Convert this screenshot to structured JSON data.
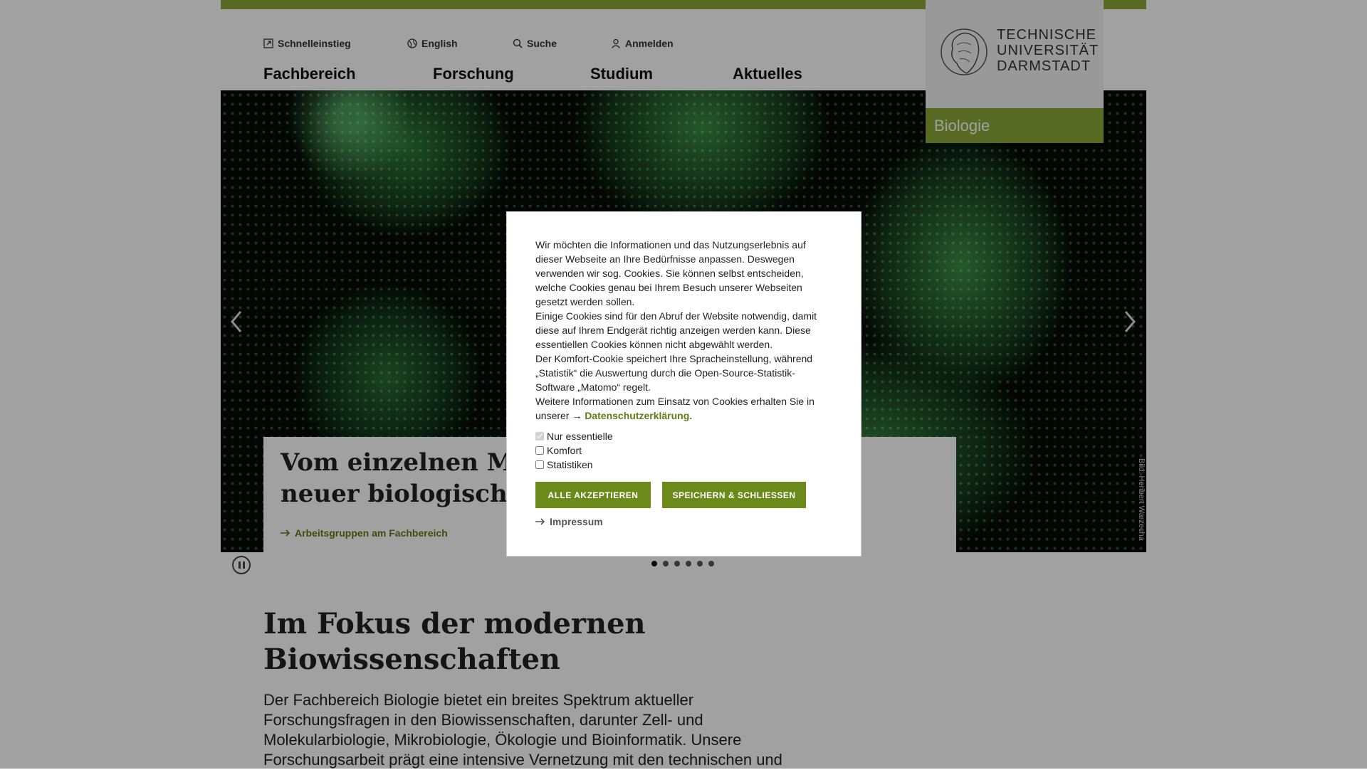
{
  "header": {
    "meta": {
      "quick": "Schnelleinstieg",
      "lang": "English",
      "search": "Suche",
      "login": "Anmelden"
    },
    "nav": [
      "Fachbereich",
      "Forschung",
      "Studium",
      "Aktuelles"
    ],
    "logo_lines": [
      "TECHNISCHE",
      "UNIVERSITÄT",
      "DARMSTADT"
    ],
    "department": "Biologie"
  },
  "hero": {
    "title": "Vom einzelnen Molekül zum Engineering neuer biologischer Systeme",
    "link": "Arbeitsgruppen am Fachbereich",
    "credit": "Bild: Heribert Warzecha",
    "slides_total": 6,
    "active_slide": 1
  },
  "intro": {
    "title": "Im Fokus der modernen Biowissenschaften",
    "text": "Der Fachbereich Biologie bietet ein breites Spektrum aktueller Forschungsfragen in den Biowissenschaften, darunter Zell- und Molekularbiologie, Mikrobiologie, Ökologie und Bioinformatik. Unsere Forschungsarbeit prägt eine intensive Vernetzung mit den technischen und"
  },
  "cookie": {
    "p1": "Wir möchten die Informationen und das Nutzungserlebnis auf dieser Webseite an Ihre Bedürfnisse anpassen. Deswegen verwenden wir sog. Cookies. Sie können selbst entscheiden, welche Cookies genau bei Ihrem Besuch unserer Webseiten gesetzt werden sollen.",
    "p2": "Einige Cookies sind für den Abruf der Website notwendig, damit diese auf Ihrem Endgerät richtig anzeigen werden kann. Diese essentiellen Cookies können nicht abgewählt werden.",
    "p3": "Der Komfort-Cookie speichert Ihre Spracheinstellung, während „Statistik“ die Auswertung durch die Open-Source-Statistik-Software „Matomo“ regelt.",
    "p4": "Weitere Informationen zum Einsatz von Cookies erhalten Sie in unserer",
    "privacy_link": "Datenschutzerklärung.",
    "options": [
      "Nur essentielle",
      "Komfort",
      "Statistiken"
    ],
    "accept_all": "ALLE AKZEPTIEREN",
    "save_close": "SPEICHERN & SCHLIESSEN",
    "impressum": "Impressum"
  },
  "colors": {
    "accent": "#8ea83a",
    "button": "#6b8a1a",
    "link": "#5d7d15"
  }
}
